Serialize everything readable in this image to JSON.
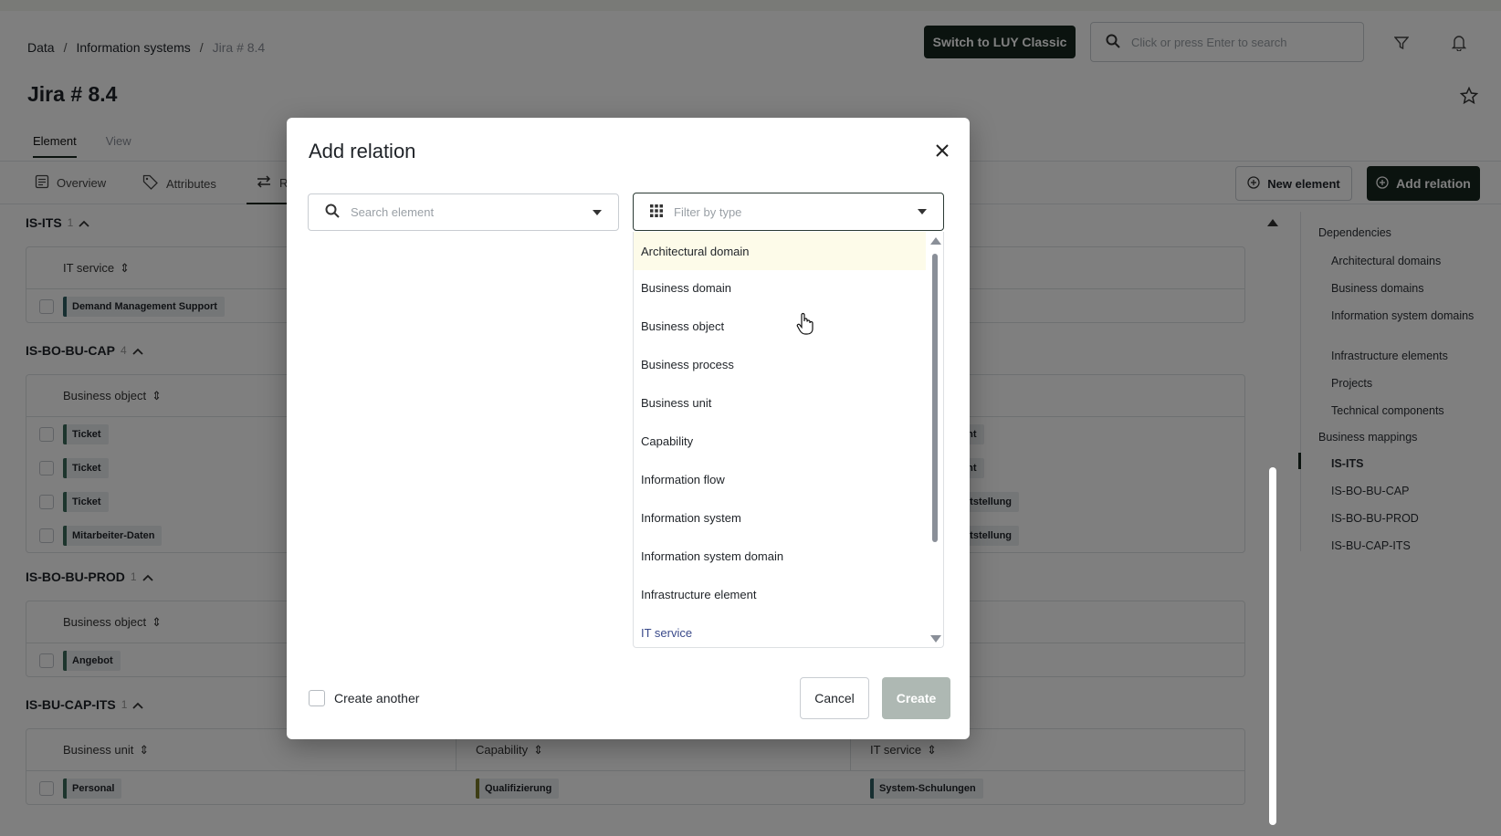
{
  "breadcrumb": [
    "Data",
    "Information systems",
    "Jira # 8.4"
  ],
  "header": {
    "switch_label": "Switch to LUY Classic",
    "search_placeholder": "Click or press Enter to search"
  },
  "page": {
    "title": "Jira # 8.4",
    "subnav": [
      "Element",
      "View"
    ],
    "tabs": [
      "Overview",
      "Attributes",
      "R"
    ],
    "new_element_label": "New element",
    "add_relation_label": "Add relation"
  },
  "sections": [
    {
      "title": "IS-ITS",
      "count": "1",
      "headers": [
        "IT service"
      ],
      "rows": [
        [
          "Demand Management Support"
        ]
      ],
      "right_rows": []
    },
    {
      "title": "IS-BO-BU-CAP",
      "count": "4",
      "headers": [
        "Business object"
      ],
      "rows": [
        [
          "Ticket"
        ],
        [
          "Ticket"
        ],
        [
          "Ticket"
        ],
        [
          "Mitarbeiter-Daten"
        ]
      ],
      "right_rows": [
        "ent",
        "ent",
        "eitstellung",
        "eitstellung"
      ]
    },
    {
      "title": "IS-BO-BU-PROD",
      "count": "1",
      "headers": [
        "Business object"
      ],
      "rows": [
        [
          "Angebot"
        ]
      ],
      "right_rows": []
    },
    {
      "title": "IS-BU-CAP-ITS",
      "count": "1",
      "headers": [
        "Business unit",
        "Capability",
        "IT service"
      ],
      "rows": [
        [
          "Personal",
          "Qualifizierung",
          "System-Schulungen"
        ]
      ],
      "right_rows": []
    }
  ],
  "rightnav": {
    "dependencies_label": "Dependencies",
    "dependencies": [
      "Architectural domains",
      "Business domains",
      "Information system domains",
      "Infrastructure elements",
      "Projects",
      "Technical components"
    ],
    "mappings_label": "Business mappings",
    "mappings": [
      "IS-ITS",
      "IS-BO-BU-CAP",
      "IS-BO-BU-PROD",
      "IS-BU-CAP-ITS"
    ],
    "active": "IS-ITS"
  },
  "modal": {
    "title": "Add relation",
    "search_placeholder": "Search element",
    "filter_placeholder": "Filter by type",
    "options": [
      "Architectural domain",
      "Business domain",
      "Business object",
      "Business process",
      "Business unit",
      "Capability",
      "Information flow",
      "Information system",
      "Information system domain",
      "Infrastructure element",
      "IT service"
    ],
    "highlighted_option": "Architectural domain",
    "create_another_label": "Create another",
    "cancel_label": "Cancel",
    "create_label": "Create"
  },
  "colors": {
    "dark_green": "#16261f",
    "chip_bu": "#3b6b5a",
    "chip_bo": "#3b6b5a",
    "chip_cap": "#7a7a2a",
    "chip_its": "#2f5e63",
    "highlight": "#fdfbe9"
  }
}
